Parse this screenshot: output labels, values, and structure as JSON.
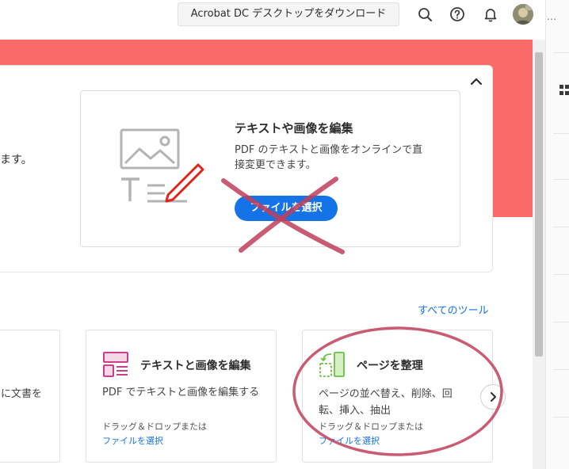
{
  "header": {
    "download_label": "Acrobat DC デスクトップをダウンロード",
    "icons": [
      "search-icon",
      "help-icon",
      "bell-icon"
    ]
  },
  "right_panel": {
    "menu_glyph": "…"
  },
  "hero": {
    "partial_text": "ます。",
    "feature_title": "テキストや画像を編集",
    "feature_desc": "PDF のテキストと画像をオンラインで直接変更できます。",
    "select_button": "ファイルを選択"
  },
  "tools": {
    "all_tools_link": "すべてのツール",
    "left_partial_desc": "に文書を",
    "cards": [
      {
        "title": "テキストと画像を編集",
        "desc": "PDF でテキストと画像を編集する",
        "drag": "ドラッグ＆ドロップまたは",
        "link": "ファイルを選択"
      },
      {
        "title": "ページを整理",
        "desc": "ページの並べ替え、削除、回転、挿入、抽出",
        "drag": "ドラッグ＆ドロップまたは",
        "link": "ファイルを選択"
      }
    ]
  },
  "colors": {
    "banner": "#fa6a68",
    "primary": "#1473e6",
    "annotation": "#c0405a",
    "edit_icon": "#c2297c",
    "organize_icon": "#6cc140"
  }
}
